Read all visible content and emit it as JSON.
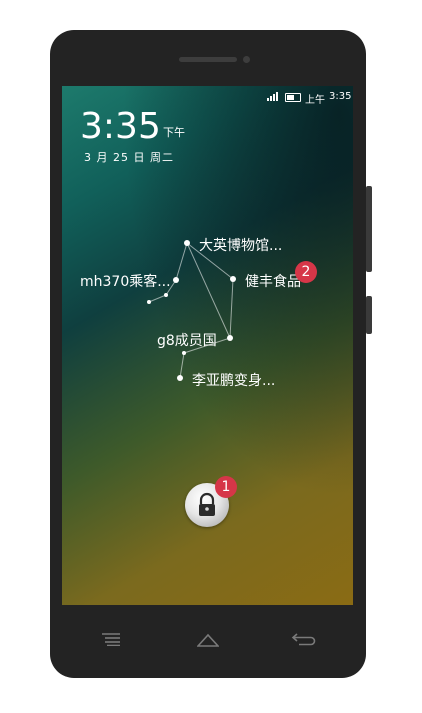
{
  "status_bar": {
    "am_pm": "上午",
    "time": "3:35"
  },
  "lock_screen": {
    "clock": {
      "time": "3:35",
      "period": "下午",
      "date": "3 月 25 日 周二"
    },
    "topics": [
      {
        "label": "大英博物馆..."
      },
      {
        "label": "mh370乘客..."
      },
      {
        "label": "健丰食品"
      },
      {
        "label": "g8成员国"
      },
      {
        "label": "李亚鹏变身..."
      }
    ],
    "badges": {
      "topic": "2",
      "lock": "1"
    }
  },
  "icons": {
    "signal": "signal-icon",
    "battery": "battery-icon",
    "lock": "lock-icon",
    "menu": "menu-icon",
    "home": "home-icon",
    "back": "back-icon"
  },
  "colors": {
    "badge": "#d63648",
    "phone_body": "#232323"
  }
}
